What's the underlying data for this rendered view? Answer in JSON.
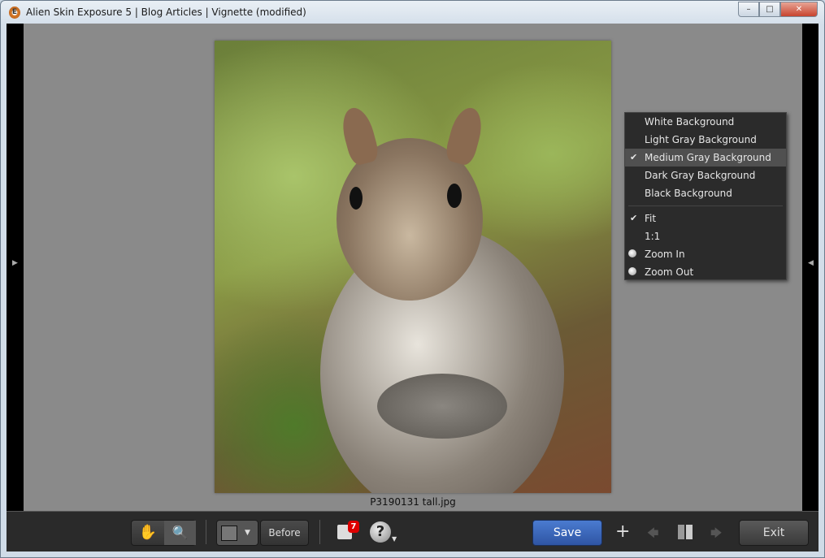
{
  "window": {
    "title": "Alien Skin Exposure 5 | Blog Articles | Vignette (modified)",
    "app_icon": "E",
    "min": "–",
    "max": "□",
    "close": "✕"
  },
  "canvas": {
    "filename": "P3190131 tall.jpg"
  },
  "menu": {
    "items": [
      {
        "label": "White Background",
        "checked": false
      },
      {
        "label": "Light Gray Background",
        "checked": false
      },
      {
        "label": "Medium Gray Background",
        "checked": true
      },
      {
        "label": "Dark Gray Background",
        "checked": false
      },
      {
        "label": "Black Background",
        "checked": false
      }
    ],
    "zoom_items": [
      {
        "label": "Fit",
        "checked": true,
        "icon": ""
      },
      {
        "label": "1:1",
        "checked": false,
        "icon": ""
      },
      {
        "label": "Zoom In",
        "checked": false,
        "icon": "zoom-in-icon"
      },
      {
        "label": "Zoom Out",
        "checked": false,
        "icon": "zoom-out-icon"
      }
    ],
    "check": "✔"
  },
  "toolbar": {
    "before": "Before",
    "save": "Save",
    "exit": "Exit",
    "notifications": "7",
    "help": "?",
    "add": "+",
    "prev": "🡄",
    "next": "🡆",
    "save_color": "#3b64b4"
  }
}
